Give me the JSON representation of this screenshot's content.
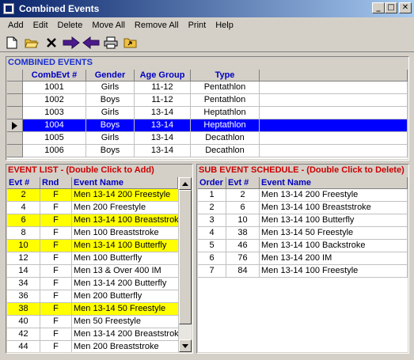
{
  "window": {
    "title": "Combined Events",
    "controls": [
      "_",
      "□",
      "✕"
    ]
  },
  "menu": [
    "Add",
    "Edit",
    "Delete",
    "Move All",
    "Remove All",
    "Print",
    "Help"
  ],
  "toolbar": [
    "new-icon",
    "open-folder-icon",
    "delete-x-icon",
    "arrow-right-icon",
    "arrow-left-icon",
    "printer-icon",
    "export-icon"
  ],
  "combined": {
    "title": "COMBINED EVENTS",
    "columns": [
      "CombEvt #",
      "Gender",
      "Age Group",
      "Type"
    ],
    "rows": [
      [
        "1001",
        "Girls",
        "11-12",
        "Pentathlon"
      ],
      [
        "1002",
        "Boys",
        "11-12",
        "Pentathlon"
      ],
      [
        "1003",
        "Girls",
        "13-14",
        "Heptathlon"
      ],
      [
        "1004",
        "Boys",
        "13-14",
        "Heptathlon"
      ],
      [
        "1005",
        "Girls",
        "13-14",
        "Decathlon"
      ],
      [
        "1006",
        "Boys",
        "13-14",
        "Decathlon"
      ]
    ],
    "selected_index": 3
  },
  "event_list": {
    "title": "EVENT LIST - (Double Click to Add)",
    "columns": [
      "Evt #",
      "Rnd",
      "Event Name"
    ],
    "rows": [
      [
        "2",
        "F",
        "Men 13-14 200 Freestyle",
        true
      ],
      [
        "4",
        "F",
        "Men 200 Freestyle",
        false
      ],
      [
        "6",
        "F",
        "Men 13-14 100 Breaststroke",
        true
      ],
      [
        "8",
        "F",
        "Men 100 Breaststroke",
        false
      ],
      [
        "10",
        "F",
        "Men 13-14 100 Butterfly",
        true
      ],
      [
        "12",
        "F",
        "Men 100 Butterfly",
        false
      ],
      [
        "14",
        "F",
        "Men 13 & Over 400 IM",
        false
      ],
      [
        "34",
        "F",
        "Men 13-14 200 Butterfly",
        false
      ],
      [
        "36",
        "F",
        "Men 200 Butterfly",
        false
      ],
      [
        "38",
        "F",
        "Men 13-14 50 Freestyle",
        true
      ],
      [
        "40",
        "F",
        "Men 50 Freestyle",
        false
      ],
      [
        "42",
        "F",
        "Men 13-14 200 Breaststroke",
        false
      ],
      [
        "44",
        "F",
        "Men 200 Breaststroke",
        false
      ]
    ],
    "highlight_color": "#ffff00"
  },
  "sub_schedule": {
    "title": "SUB EVENT SCHEDULE - (Double Click to Delete)",
    "columns": [
      "Order",
      "Evt #",
      "Event Name"
    ],
    "rows": [
      [
        "1",
        "2",
        "Men 13-14 200 Freestyle"
      ],
      [
        "2",
        "6",
        "Men 13-14 100 Breaststroke"
      ],
      [
        "3",
        "10",
        "Men 13-14 100 Butterfly"
      ],
      [
        "4",
        "38",
        "Men 13-14 50 Freestyle"
      ],
      [
        "5",
        "46",
        "Men 13-14 100 Backstroke"
      ],
      [
        "6",
        "76",
        "Men 13-14 200 IM"
      ],
      [
        "7",
        "84",
        "Men 13-14 100 Freestyle"
      ]
    ]
  },
  "colors": {
    "selection": "#0000ff",
    "header_text": "#0000c0",
    "title_red": "#cc0000"
  }
}
